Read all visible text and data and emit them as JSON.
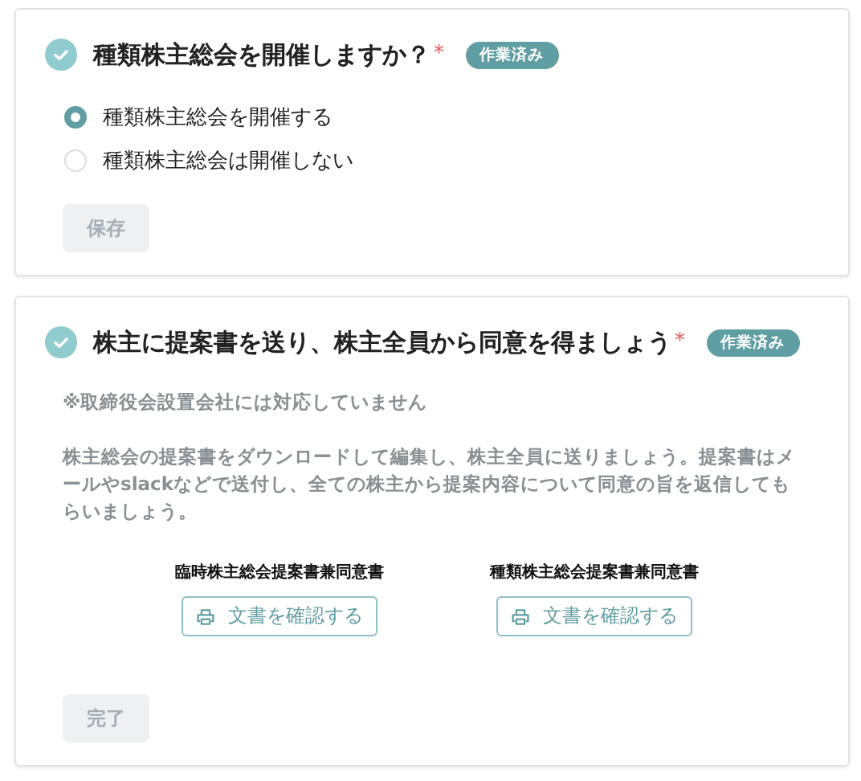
{
  "sections": [
    {
      "kind": "choice",
      "done": true,
      "title": "種類株主総会を開催しますか？",
      "required_mark": "*",
      "badge": "作業済み",
      "options": [
        {
          "label": "種類株主総会を開催する",
          "selected": true
        },
        {
          "label": "種類株主総会は開催しない",
          "selected": false
        }
      ],
      "button": {
        "label": "保存",
        "disabled": true
      }
    },
    {
      "kind": "documents",
      "done": true,
      "title": "株主に提案書を送り、株主全員から同意を得ましょう",
      "required_mark": "*",
      "badge": "作業済み",
      "note": "※取締役会設置会社には対応していません",
      "description": "株主総会の提案書をダウンロードして編集し、株主全員に送りましょう。提案書はメールやslackなどで送付し、全ての株主から提案内容について同意の旨を返信してもらいましょう。",
      "documents": [
        {
          "title": "臨時株主総会提案書兼同意書",
          "button": "文書を確認する"
        },
        {
          "title": "種類株主総会提案書兼同意書",
          "button": "文書を確認する"
        }
      ],
      "button": {
        "label": "完了",
        "disabled": true
      }
    }
  ]
}
